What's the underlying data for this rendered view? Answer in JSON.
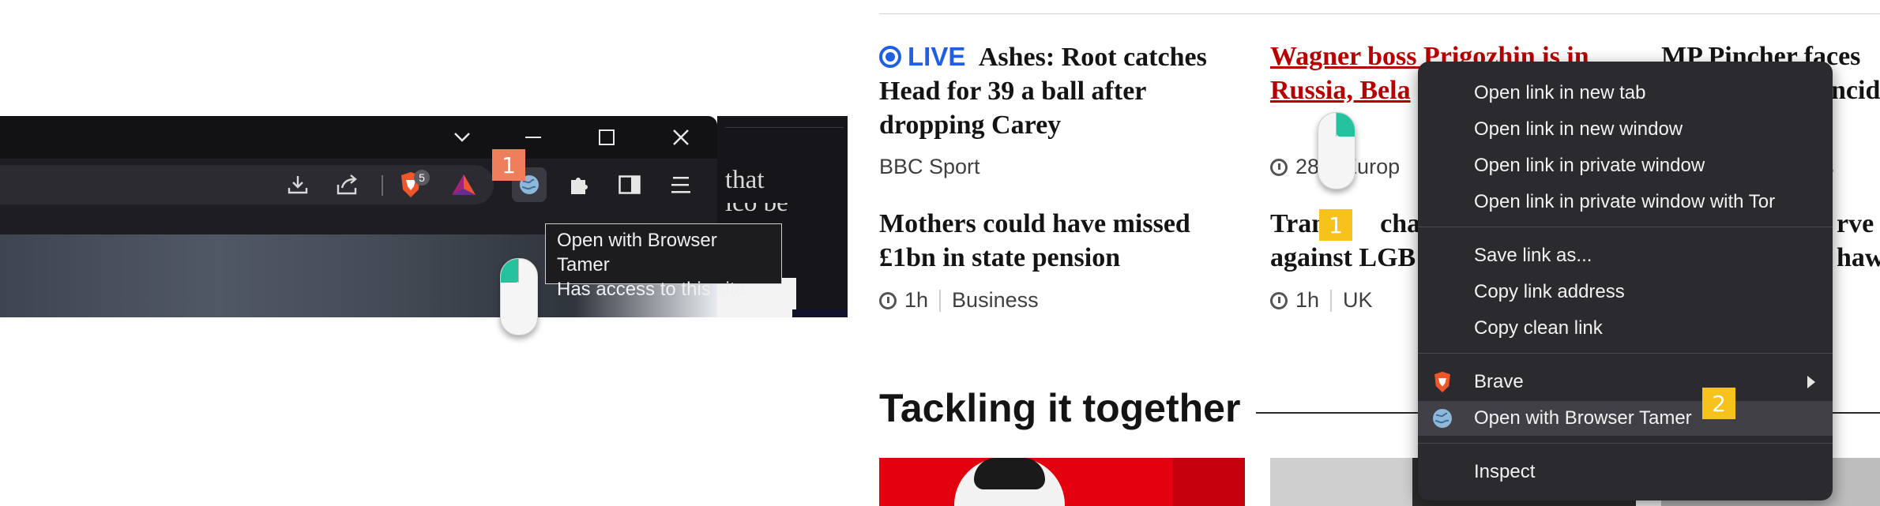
{
  "browser": {
    "tooltip_line1": "Open with Browser Tamer",
    "tooltip_line2": "Has access to this site",
    "shield_count": "5",
    "behind_text": "that",
    "behind_text2": "ico be",
    "callout1": "1"
  },
  "bbc": {
    "stories": [
      {
        "live_label": "LIVE",
        "title": "Ashes: Root catches Head for 39 a ball after dropping Carey",
        "source": "BBC Sport"
      },
      {
        "title": "Mothers could have missed £1bn in state pension",
        "time": "1h",
        "category": "Business"
      },
      {
        "title_line1": "Wagner boss Prigozhin is in",
        "title_line2": "Russia, Bela",
        "time": "28",
        "category": "Europ"
      },
      {
        "title_line1": "Tran",
        "title_line1b": "charit",
        "title_line2": "against LGB",
        "time": "1h",
        "category": "UK"
      },
      {
        "title_line1": "MP Pincher faces",
        "title_line2": "ncid",
        "meta": "s"
      },
      {
        "title_line1": "rve",
        "title_line2": "hawa"
      }
    ],
    "section_title": "Tackling it together",
    "callout_mouse": "1"
  },
  "context_menu": {
    "items": [
      "Open link in new tab",
      "Open link in new window",
      "Open link in private window",
      "Open link in private window with Tor",
      "Save link as...",
      "Copy link address",
      "Copy clean link",
      "Brave",
      "Open with Browser Tamer",
      "Inspect"
    ],
    "callout": "2"
  },
  "colors": {
    "live_blue": "#1f5fe6",
    "callout_orange": "#ef7e5d",
    "callout_yellow": "#f7c21b",
    "link_red": "#b80000",
    "menu_bg": "#2b2b2f"
  }
}
